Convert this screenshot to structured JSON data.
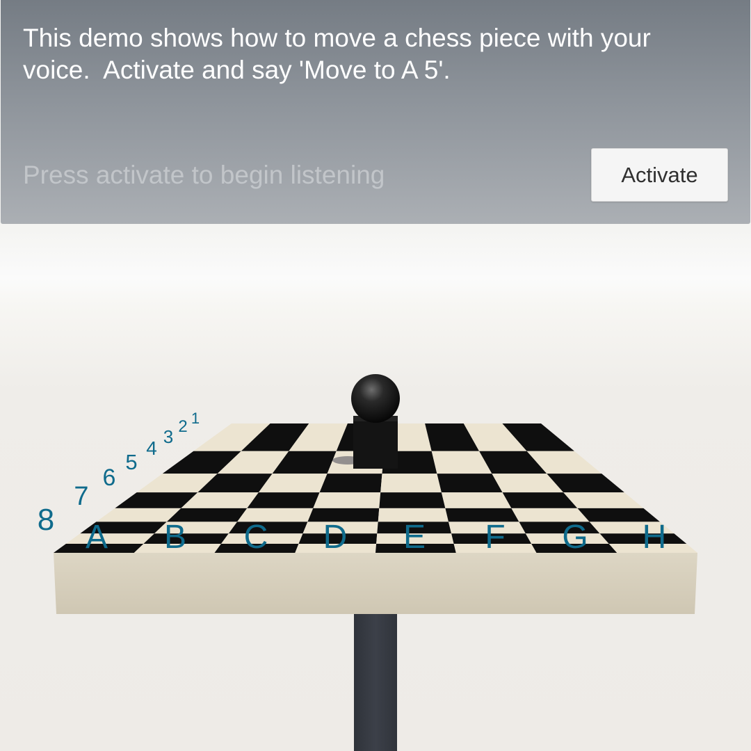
{
  "panel": {
    "instructions": "This demo shows how to move a chess piece with your\nvoice.  Activate and say 'Move to A 5'.",
    "status": "Press activate to begin listening",
    "activate_label": "Activate"
  },
  "board": {
    "columns": [
      "A",
      "B",
      "C",
      "D",
      "E",
      "F",
      "G",
      "H"
    ],
    "rows": [
      "8",
      "7",
      "6",
      "5",
      "4",
      "3",
      "2",
      "1"
    ],
    "colors": {
      "light_square": "#ece4d1",
      "dark_square": "#0f0f0f",
      "edge": "#d0c8b6",
      "label": "#0f6b8c",
      "piece": "#111111",
      "stand": "#383c44"
    }
  }
}
